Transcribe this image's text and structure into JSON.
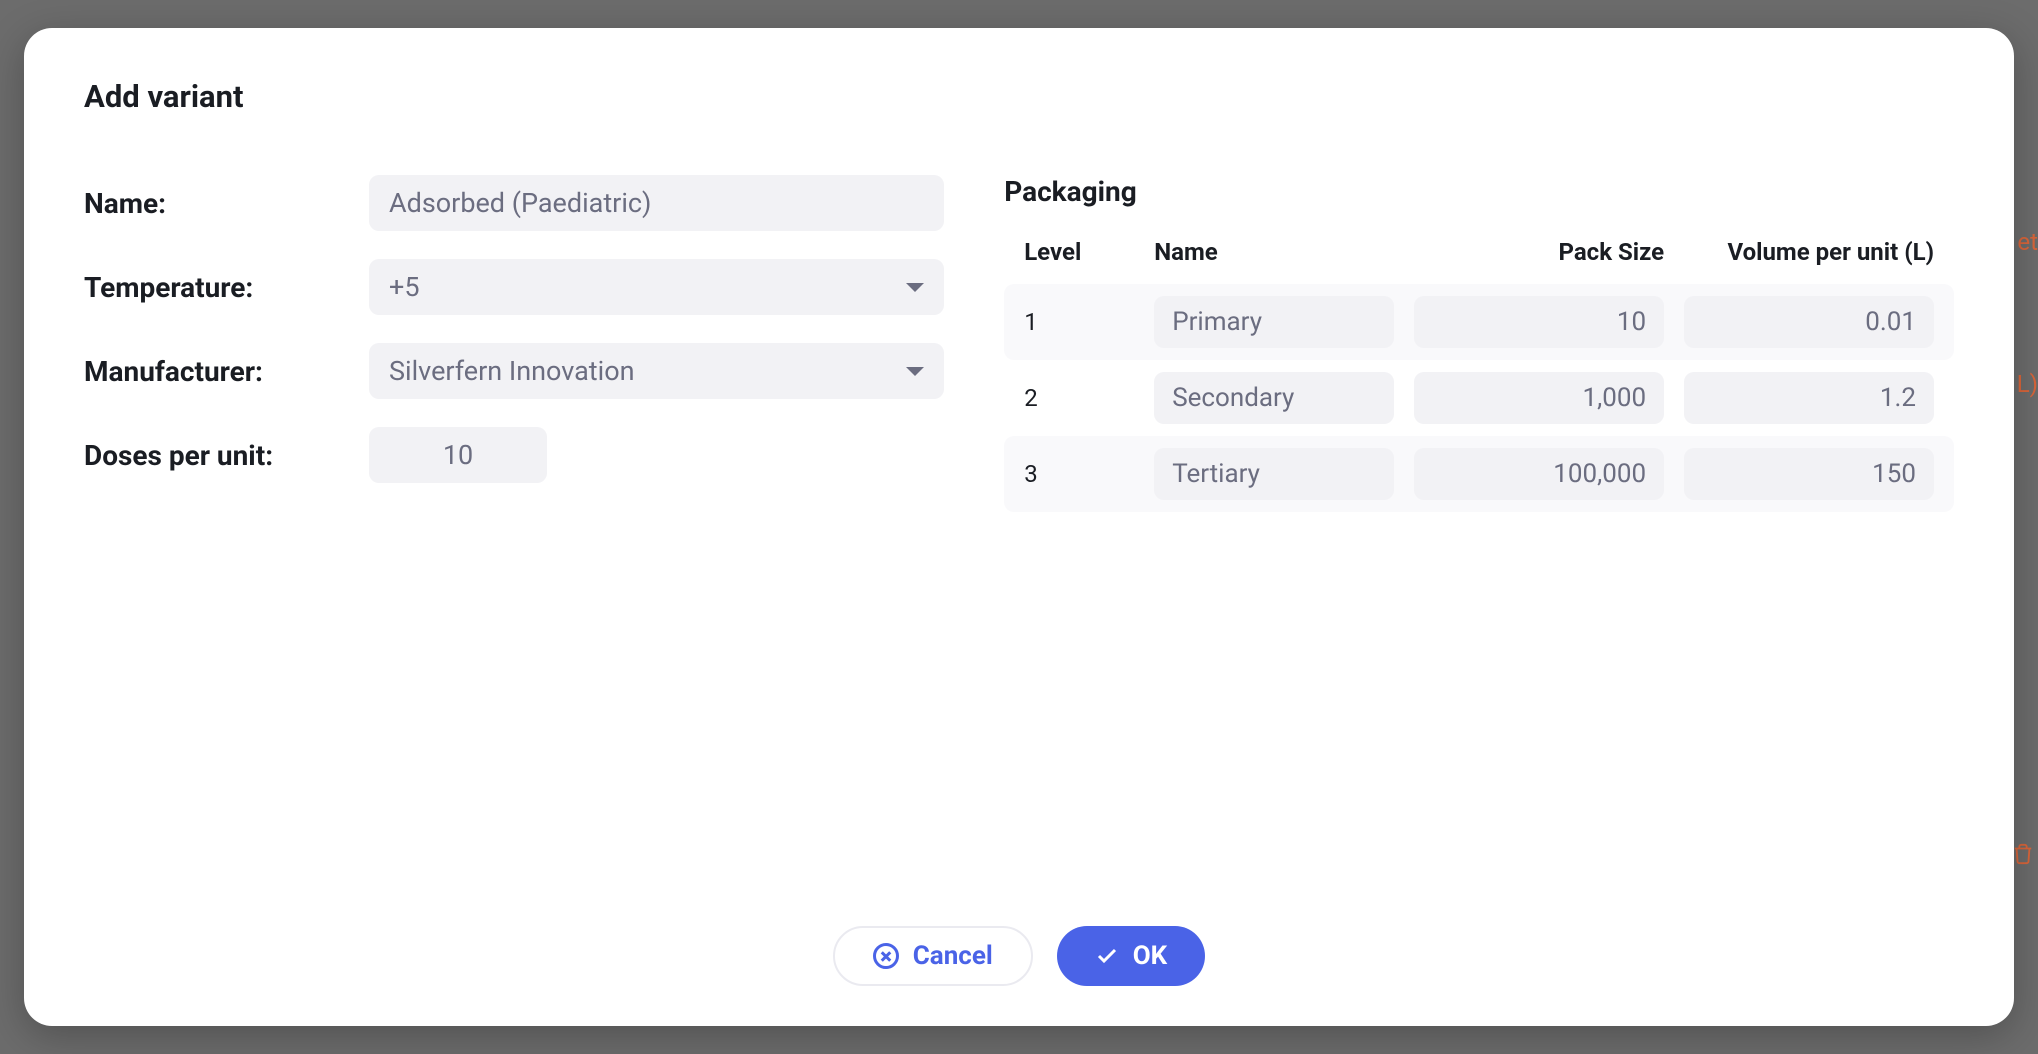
{
  "modal": {
    "title": "Add variant"
  },
  "form": {
    "name_label": "Name:",
    "name_value": "Adsorbed (Paediatric)",
    "temperature_label": "Temperature:",
    "temperature_value": "+5",
    "manufacturer_label": "Manufacturer:",
    "manufacturer_value": "Silverfern Innovation",
    "doses_label": "Doses per unit:",
    "doses_value": "10"
  },
  "packaging": {
    "title": "Packaging",
    "headers": {
      "level": "Level",
      "name": "Name",
      "pack_size": "Pack Size",
      "volume": "Volume per unit (L)"
    },
    "rows": [
      {
        "level": "1",
        "name": "Primary",
        "pack_size": "10",
        "volume": "0.01"
      },
      {
        "level": "2",
        "name": "Secondary",
        "pack_size": "1,000",
        "volume": "1.2"
      },
      {
        "level": "3",
        "name": "Tertiary",
        "pack_size": "100,000",
        "volume": "150"
      }
    ]
  },
  "footer": {
    "cancel": "Cancel",
    "ok": "OK"
  },
  "background_hints": {
    "text1": "et",
    "text2": "L)"
  }
}
